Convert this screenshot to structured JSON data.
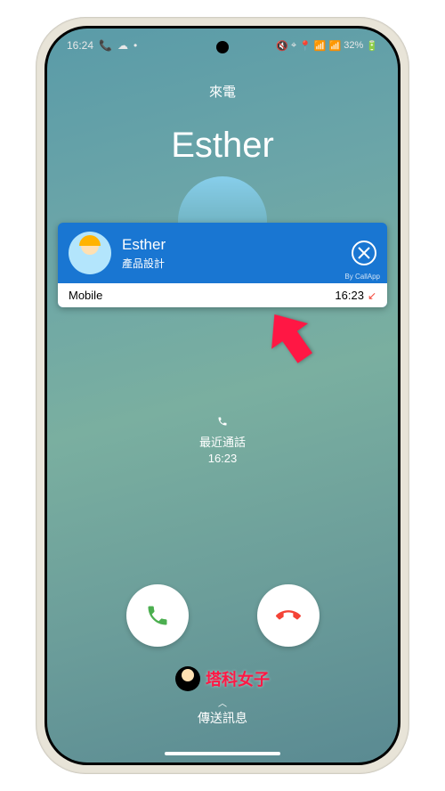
{
  "status": {
    "time": "16:24",
    "battery": "32%"
  },
  "call": {
    "incoming_label": "來電",
    "caller_name": "Esther"
  },
  "overlay": {
    "name": "Esther",
    "subtitle": "產品設計",
    "brand": "By CallApp",
    "phone_type": "Mobile",
    "call_time": "16:23"
  },
  "recent": {
    "label": "最近通話",
    "time": "16:23"
  },
  "watermark": {
    "text": "塔科女子"
  },
  "send_message": {
    "label": "傳送訊息"
  }
}
